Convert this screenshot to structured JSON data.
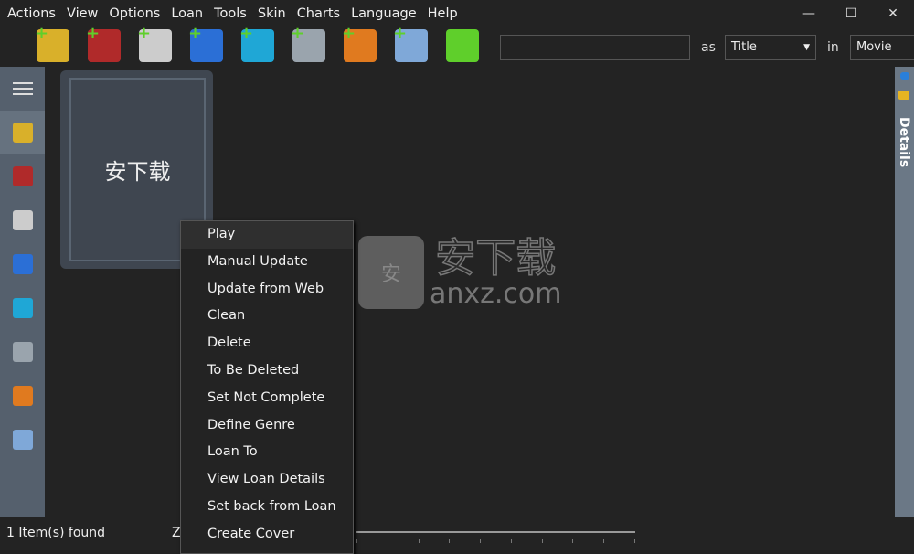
{
  "menu": [
    "Actions",
    "View",
    "Options",
    "Loan",
    "Tools",
    "Skin",
    "Charts",
    "Language",
    "Help"
  ],
  "window_controls": {
    "minimize": "—",
    "maximize": "☐",
    "close": "✕"
  },
  "toolbar": [
    {
      "icon": "add-tools-icon",
      "color": "#d9b02a"
    },
    {
      "icon": "add-book-icon",
      "color": "#b02a2a"
    },
    {
      "icon": "add-game-icon",
      "color": "#cccccc"
    },
    {
      "icon": "add-movie-icon",
      "color": "#2b6fd6"
    },
    {
      "icon": "add-music-icon",
      "color": "#1fa7d6"
    },
    {
      "icon": "add-handheld-icon",
      "color": "#9aa4ad"
    },
    {
      "icon": "add-tv-icon",
      "color": "#e07a1f"
    },
    {
      "icon": "add-xfolder-icon",
      "color": "#7fa8d8"
    },
    {
      "icon": "download-icon",
      "color": "#5fcf2b"
    }
  ],
  "search": {
    "value": "",
    "as_label": "as",
    "as_value": "Title",
    "in_label": "in",
    "in_value": "Movie"
  },
  "sidebar": [
    {
      "icon": "tools-icon",
      "color": "#d9b02a",
      "active": true
    },
    {
      "icon": "book-icon",
      "color": "#b02a2a"
    },
    {
      "icon": "game-icon",
      "color": "#cccccc"
    },
    {
      "icon": "movie-icon",
      "color": "#2b6fd6"
    },
    {
      "icon": "music-icon",
      "color": "#1fa7d6"
    },
    {
      "icon": "handheld-icon",
      "color": "#9aa4ad"
    },
    {
      "icon": "tv-icon",
      "color": "#e07a1f"
    },
    {
      "icon": "xfolder-icon",
      "color": "#7fa8d8"
    }
  ],
  "card": {
    "title": "安下载"
  },
  "details_panel": {
    "label": "Details"
  },
  "context_menu": [
    "Play",
    "Manual Update",
    "Update from Web",
    "Clean",
    "Delete",
    "To Be Deleted",
    "Set Not Complete",
    "Define Genre",
    "Loan To",
    "View Loan Details",
    "Set back from Loan",
    "Create Cover"
  ],
  "status": {
    "found": "1 Item(s) found",
    "zoom_label": "Z"
  },
  "watermark": {
    "cn": "安下载",
    "en": "anxz.com",
    "badge": "安"
  }
}
